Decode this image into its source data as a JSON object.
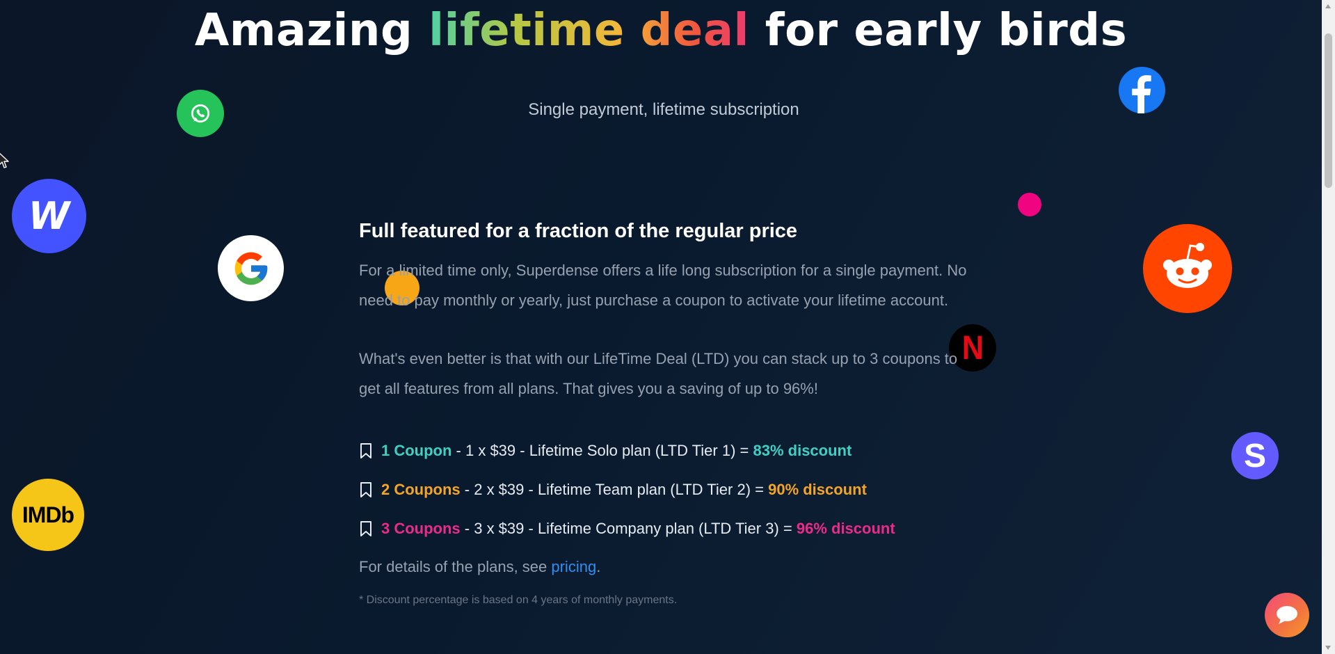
{
  "hero": {
    "title_part1": "Amazing ",
    "title_part2": "lifetime",
    "title_space": " ",
    "title_part3": "deal",
    "title_part4": " for early birds",
    "subtitle": "Single payment, lifetime subscription"
  },
  "section": {
    "title": "Full featured for a fraction of the regular price",
    "paragraph1": "For a limited time only, Superdense offers a life long subscription for a single payment. No need to pay monthly or yearly, just purchase a coupon to activate your lifetime account.",
    "paragraph2": "What's even better is that with our LifeTime Deal (LTD) you can stack up to 3 coupons to get all features from all plans. That gives you a saving of up to 96%!"
  },
  "coupons": [
    {
      "label": "1 Coupon",
      "text": " - 1 x $39 - Lifetime Solo plan (LTD Tier 1) = ",
      "discount": "83% discount"
    },
    {
      "label": "2 Coupons",
      "text": " - 2 x $39 - Lifetime Team plan (LTD Tier 2) = ",
      "discount": "90% discount"
    },
    {
      "label": "3 Coupons",
      "text": " - 3 x $39 - Lifetime Company plan (LTD Tier 3) = ",
      "discount": "96% discount"
    }
  ],
  "details": {
    "prefix": "For details of the plans, see ",
    "link": "pricing",
    "suffix": "."
  },
  "footnote": "* Discount percentage is based on 4 years of monthly payments.",
  "icons": {
    "whatsapp": "whatsapp-icon",
    "webflow": "webflow-icon",
    "google": "google-icon",
    "imdb": "imdb-icon",
    "facebook": "facebook-icon",
    "reddit": "reddit-icon",
    "netflix": "netflix-icon",
    "stripe": "stripe-icon",
    "chat": "chat-icon"
  },
  "logo_text": {
    "webflow": "W",
    "imdb": "IMDb",
    "netflix": "N",
    "stripe": "S"
  },
  "colors": {
    "accent_teal": "#3fd0c4",
    "accent_orange": "#f5a524",
    "accent_pink": "#ec2a8a",
    "link": "#2e8ff0"
  }
}
